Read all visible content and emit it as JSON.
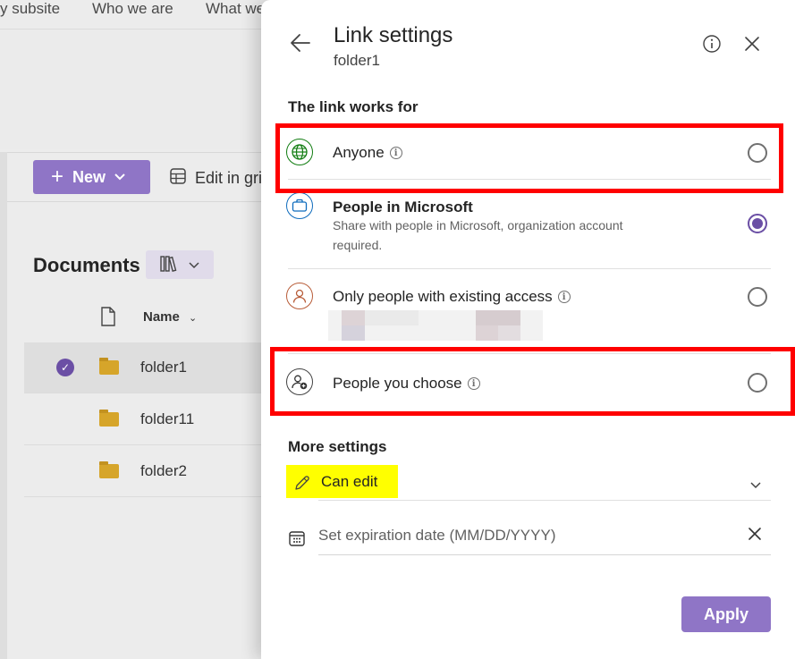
{
  "background": {
    "top_nav": [
      "y subsite",
      "Who we are",
      "What we"
    ],
    "new_button": "New",
    "edit_grid": "Edit in gri",
    "documents_title": "Documents",
    "column_name": "Name",
    "files": [
      "folder1",
      "folder11",
      "folder2"
    ]
  },
  "panel": {
    "title": "Link settings",
    "subtitle": "folder1",
    "link_works_for_heading": "The link works for",
    "options": [
      {
        "label": "Anyone",
        "description": "",
        "selected": false,
        "icon": "globe-icon"
      },
      {
        "label": "People in Microsoft",
        "description": "Share with people in Microsoft, organization account required.",
        "selected": true,
        "icon": "briefcase-icon"
      },
      {
        "label": "Only people with existing access",
        "description": "",
        "selected": false,
        "icon": "person-icon"
      },
      {
        "label": "People you choose",
        "description": "",
        "selected": false,
        "icon": "person-add-icon"
      }
    ],
    "more_settings_heading": "More settings",
    "permission": "Can edit",
    "expiration_placeholder": "Set expiration date (MM/DD/YYYY)",
    "apply_label": "Apply"
  },
  "colors": {
    "accent": "#8f75c6",
    "accent_dark": "#6b4fa5",
    "annotation_red": "#ff0000",
    "highlight_yellow": "#ffff00"
  }
}
